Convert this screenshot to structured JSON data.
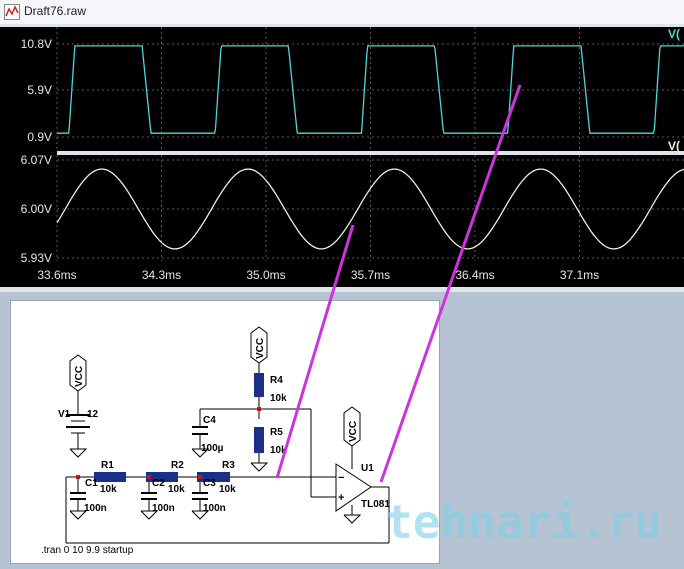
{
  "window": {
    "title": "Draft76.raw"
  },
  "plot": {
    "trace_top_label": "V(",
    "trace_bottom_label": "V(",
    "top_y_ticks": [
      "10.8V",
      "5.9V",
      "0.9V"
    ],
    "bottom_y_ticks": [
      "6.07V",
      "6.00V",
      "5.93V"
    ],
    "x_ticks": [
      "33.6ms",
      "34.3ms",
      "35.0ms",
      "35.7ms",
      "36.4ms",
      "37.1ms"
    ],
    "top_trace_color": "#4fd6d6",
    "bottom_trace_color": "#f2f2c8",
    "background_color": "#000000",
    "grid_color": "#5a5a5a",
    "tick_label_color": "#e6e6e6"
  },
  "chart_data": [
    {
      "type": "line",
      "title": "",
      "xlabel": "",
      "ylabel": "",
      "x_range_ms": [
        33.6,
        37.8
      ],
      "ylim": [
        0.9,
        10.8
      ],
      "series": [
        {
          "name": "V(",
          "shape": "square",
          "period_ms": 0.98,
          "high": 10.6,
          "low": 1.3
        }
      ]
    },
    {
      "type": "line",
      "title": "",
      "xlabel": "",
      "ylabel": "",
      "x_range_ms": [
        33.6,
        37.8
      ],
      "ylim": [
        5.93,
        6.07
      ],
      "series": [
        {
          "name": "V(",
          "shape": "sine",
          "period_ms": 0.98,
          "center": 6.0,
          "amplitude": 0.057
        }
      ]
    }
  ],
  "schematic": {
    "v1_name": "V1",
    "v1_value": "12",
    "vcc": "VCC",
    "r1": "R1",
    "r1_val": "10k",
    "r2": "R2",
    "r2_val": "10k",
    "r3": "R3",
    "r3_val": "10k",
    "r4": "R4",
    "r4_val": "10k",
    "r5": "R5",
    "r5_val": "10k",
    "c1": "C1",
    "c1_val": "100n",
    "c2": "C2",
    "c2_val": "100n",
    "c3": "C3",
    "c3_val": "100n",
    "c4": "C4",
    "c4_val": "100µ",
    "u1": "U1",
    "u1_part": "TL081",
    "directive": ".tran 0 10 9.9 startup",
    "wire_color": "#000000",
    "component_color": "#1a2f86",
    "node_color": "#d01010"
  },
  "annotations": {
    "arrow_color": "#cc33dd"
  },
  "watermark": {
    "text": "tehnari.ru",
    "color": "#7dd0e6"
  }
}
